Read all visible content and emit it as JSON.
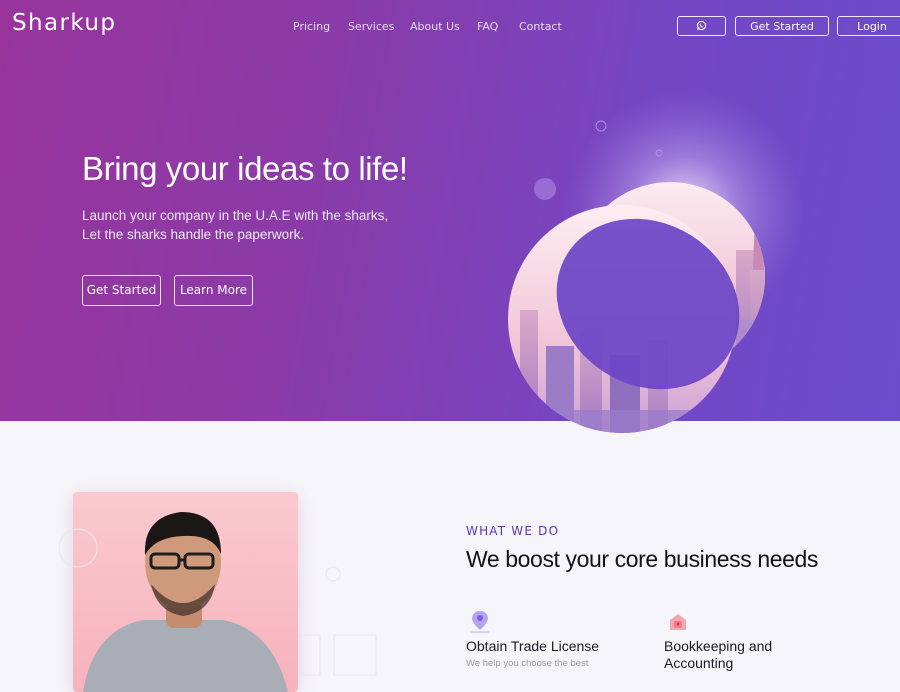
{
  "header": {
    "logo": "Sharkup",
    "nav": [
      "Pricing",
      "Services",
      "About Us",
      "FAQ",
      "Contact"
    ],
    "whatsapp_icon": "whatsapp-icon",
    "get_started": "Get Started",
    "login": "Login"
  },
  "hero": {
    "title": "Bring your ideas to life!",
    "subtitle_line1": "Launch your company in the U.A.E with the sharks,",
    "subtitle_line2": "Let the sharks handle the paperwork.",
    "primary_button": "Get Started",
    "secondary_button": "Learn More"
  },
  "what_we_do": {
    "kicker": "WHAT WE DO",
    "title": "We boost your core business needs",
    "services": [
      {
        "icon": "location-pin-icon",
        "title": "Obtain Trade License",
        "description": "We help you choose the best"
      },
      {
        "icon": "piggy-bank-icon",
        "title_line1": "Bookkeeping and",
        "title_line2": "Accounting"
      }
    ]
  },
  "colors": {
    "hero_start": "#98349c",
    "hero_end": "#6b4dcc",
    "accent": "#5b36b8",
    "background": "#f6f6fa"
  }
}
